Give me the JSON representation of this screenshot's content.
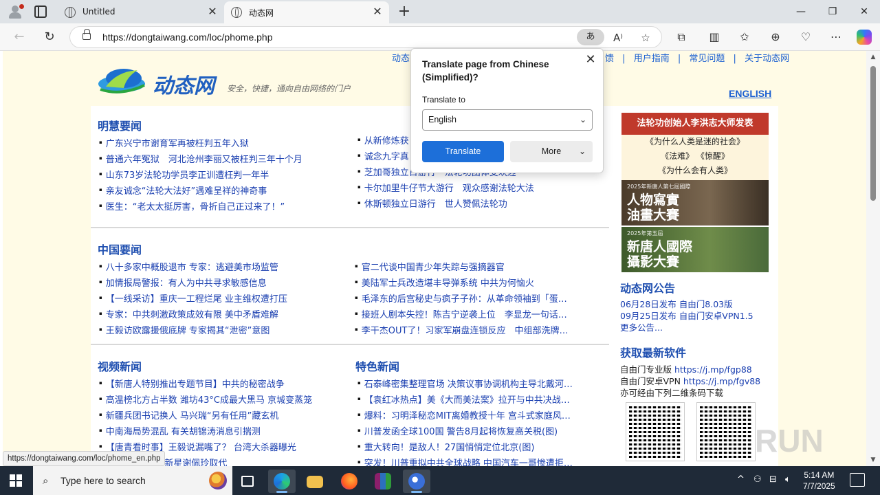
{
  "browser": {
    "tabs": [
      {
        "title": "Untitled"
      },
      {
        "title": "动态网"
      }
    ],
    "url": "https://dongtaiwang.com/loc/phome.php",
    "translate_indicator": "あ",
    "status_url": "https://dongtaiwang.com/loc/phome_en.php"
  },
  "translate_popup": {
    "title": "Translate page from Chinese (Simplified)?",
    "label": "Translate to",
    "selected_language": "English",
    "translate_button": "Translate",
    "more_button": "More"
  },
  "site": {
    "logo_text": "动态网",
    "slogan": "安全，快捷，通向自由网络的门户",
    "english_link": "ENGLISH",
    "top_links_left": "动态",
    "top_links_right": [
      "馈",
      "|",
      "用户指南",
      "|",
      "常见问题",
      "|",
      "关于动态网"
    ]
  },
  "sections": {
    "minghui": {
      "title": "明慧要闻",
      "left": [
        "广东兴宁市谢育军再被枉判五年入狱",
        "普通六年冤狱　河北沧州李丽又被枉判三年十个月",
        "山东73岁法轮功学员李正训遭枉判一年半",
        "亲友诚念“法轮大法好”遇难呈祥的神奇事",
        "医生：“老太太挺厉害，骨折自己正过来了！”"
      ],
      "right": [
        "从新修炼获",
        "诚念九字真",
        "芝加哥独立日游行　法轮功团体受欢迎",
        "卡尔加里牛仔节大游行　观众感谢法轮大法",
        "休斯顿独立日游行　世人赞佩法轮功"
      ]
    },
    "china": {
      "title": "中国要闻",
      "left": [
        "八十多家中概股退市 专家：逃避美市场监管",
        "加情报局警报：有人为中共寻求敏感信息",
        "【一线采访】重庆一工程烂尾 业主维权遭打压",
        "专家：中共刺激政策成效有限 美中矛盾难解",
        "王毅访欧露援俄底牌 专家揭其“泄密”意图"
      ],
      "right": [
        "官二代谈中国青少年失踪与强摘器官",
        "美陆军士兵改造堪丰导弹系统 中共为何恼火",
        "毛泽东的后宫秘史与疯子子孙：从革命领袖到「蛋…",
        "接班人剧本失控！陈吉宁逆袭上位　李显龙一句话…",
        "李干杰OUT了！习家军崩盘连锁反应　中组部洗牌…"
      ]
    },
    "video": {
      "title": "视频新闻",
      "items": [
        "【新唐人特别推出专题节目】中共的秘密战争",
        "高温榜北方占半数 潍坊43°C成最大黑马 京城变蒸笼",
        "新疆兵团书记换人 马兴瑞“另有任用”藏玄机",
        "中南海局势混乱 有关胡锦涛消息引揣测",
        "【唐青看时事】王毅说漏嘴了？ 台湾大杀器曝光",
        "席 位置被15岁新星谢佩玲取代"
      ]
    },
    "featured": {
      "title": "特色新闻",
      "items": [
        "石泰峰密集整理官场 决策议事协调机构主导北戴河…",
        "【袁红冰热点】美《大而美法案》拉开与中共决战…",
        "爆料：习明泽秘恋MIT离婚教授十年 宫斗式家庭风…",
        "川普发函全球100国 警告8月起将恢复高关税(图)",
        "重大转向！是敌人！27国悄悄定位北京(图)",
        "突发！川普重拟中共全球战略 中国汽车一哥惨遭拒…"
      ]
    }
  },
  "sidebar": {
    "banner1": {
      "head": "法轮功创始人李洪志大师发表",
      "lines": [
        "《为什么人类是迷的社会》",
        "《法难》 《惊醒》",
        "《为什么会有人类》"
      ]
    },
    "banner2": {
      "small": "2025年新唐人第七屆國際",
      "big": "人物寫實\n油畫大賽"
    },
    "banner3": {
      "small": "2025年第五屆",
      "big": "新唐人國際\n攝影大賽"
    },
    "announce_title": "动态网公告",
    "announce": [
      "06月28日发布 自由门8.03版",
      "09月25日发布 自由门安卓VPN1.5",
      "更多公告..."
    ],
    "software_title": "获取最新软件",
    "software": [
      {
        "label": "自由门专业版 ",
        "link": "https://j.mp/fgp88"
      },
      {
        "label": "自由门安卓VPN ",
        "link": "https://j.mp/fgv88"
      },
      {
        "label": "亦可经由下列二维条码下载",
        "link": ""
      }
    ]
  },
  "watermark": "RUN",
  "taskbar": {
    "search_placeholder": "Type here to search",
    "time": "5:14 AM",
    "date": "7/7/2025"
  }
}
